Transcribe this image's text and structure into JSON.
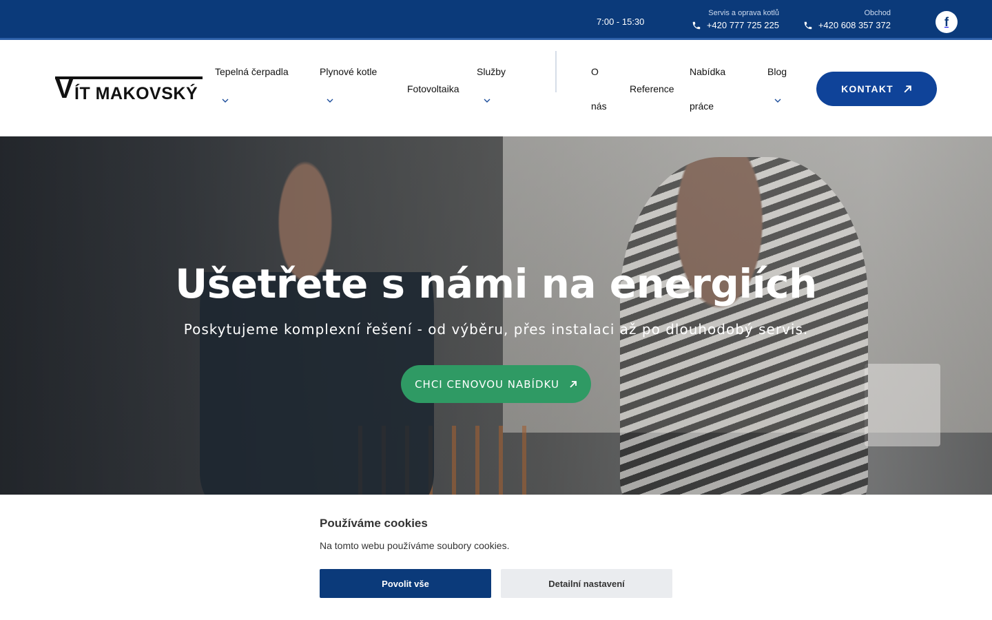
{
  "topbar": {
    "hours": "7:00 - 15:30",
    "phones": [
      {
        "caption": "Servis a oprava kotlů",
        "number": "+420 777 725 225"
      },
      {
        "caption": "Obchod",
        "number": "+420 608 357 372"
      }
    ],
    "social": {
      "facebook_glyph": "f",
      "icon": "facebook-icon"
    }
  },
  "header": {
    "logo": {
      "initial": "V",
      "rest": "ÍT MAKOVSKÝ"
    },
    "nav": {
      "tepelna": "Tepelná čerpadla",
      "plynove": "Plynové kotle",
      "fotovoltaika": "Fotovoltaika",
      "sluzby": "Služby",
      "o_nas_1": "O",
      "o_nas_2": "nás",
      "reference": "Reference",
      "nabidka_1": "Nabídka",
      "nabidka_2": "práce",
      "blog": "Blog"
    },
    "cta": "KONTAKT"
  },
  "hero": {
    "title": "Ušetřete s námi na energiích",
    "subtitle": "Poskytujeme komplexní řešení - od výběru, přes instalaci až po dlouhodobý servis.",
    "cta": "CHCI CENOVOU NABÍDKU"
  },
  "cookie": {
    "title": "Používáme cookies",
    "text": "Na tomto webu používáme soubory cookies.",
    "allow": "Povolit vše",
    "details": "Detailní nastavení"
  },
  "colors": {
    "topbar": "#0b3a7a",
    "primary_button": "#0f4399",
    "offer_button": "#2f9a64",
    "cookie_allow": "#0b3a7a",
    "cookie_details": "#eaecef"
  }
}
